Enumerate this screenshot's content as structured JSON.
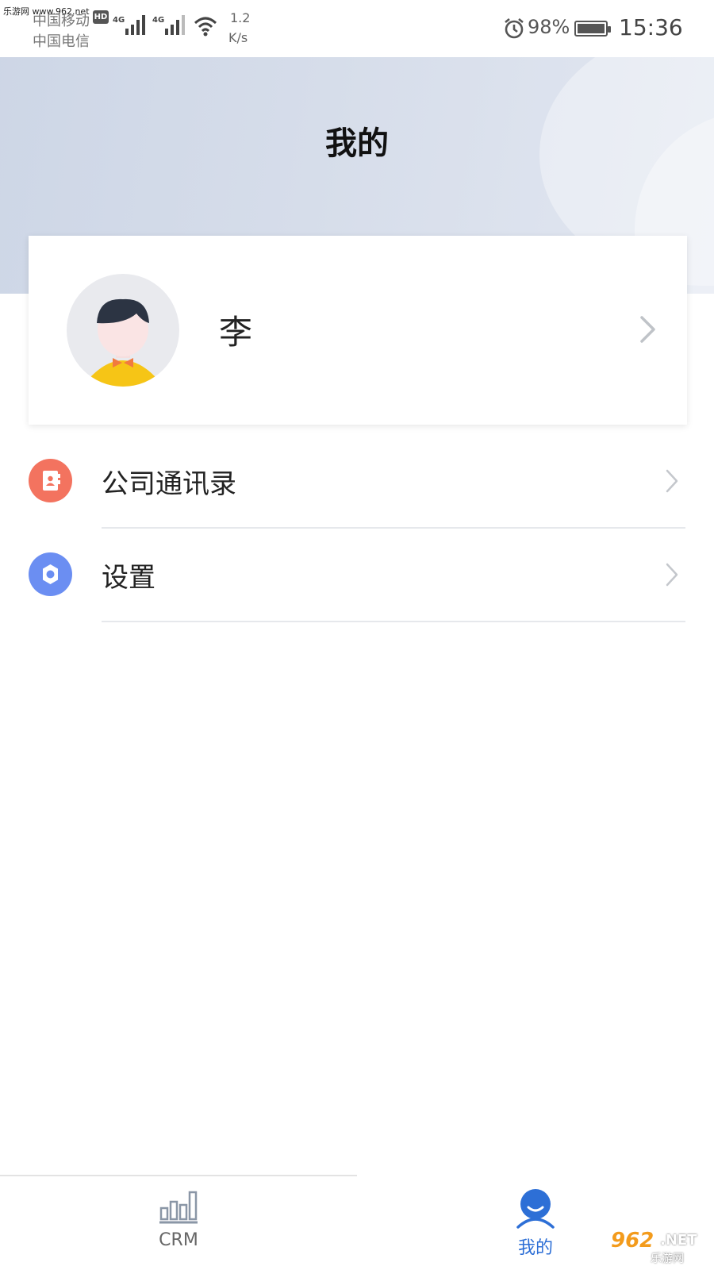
{
  "status_bar": {
    "watermark": "乐游网 www.962.net",
    "carrier_1": "中国移动",
    "carrier_2": "中国电信",
    "hd": "HD",
    "network_1": "4G",
    "network_2": "4G",
    "speed_value": "1.2",
    "speed_unit": "K/s",
    "battery": "98%",
    "time": "15:36"
  },
  "header": {
    "title": "我的"
  },
  "profile": {
    "name": "李"
  },
  "menu": [
    {
      "label": "公司通讯录",
      "icon": "contacts-book-icon",
      "color": "#f3735f"
    },
    {
      "label": "设置",
      "icon": "gear-icon",
      "color": "#6b8ef2"
    }
  ],
  "tabbar": {
    "tabs": [
      {
        "label": "CRM",
        "icon": "bar-chart-icon",
        "active": false
      },
      {
        "label": "我的",
        "icon": "user-icon",
        "active": true
      }
    ],
    "active_color": "#2d6fd6"
  },
  "watermark_logo": {
    "brand": "962",
    "suffix": ".NET",
    "sub": "乐游网"
  }
}
